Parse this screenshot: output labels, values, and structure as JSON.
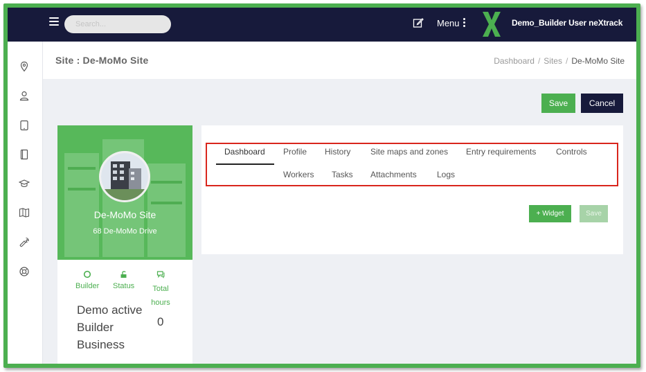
{
  "topbar": {
    "search_placeholder": "Search...",
    "menu_label": "Menu",
    "user_label": "Demo_Builder User neXtrack"
  },
  "sidebar": {
    "icons": [
      "location-pin-icon",
      "user-icon",
      "tablet-icon",
      "book-icon",
      "graduation-cap-icon",
      "map-book-icon",
      "wrench-icon",
      "lifebuoy-icon"
    ]
  },
  "page": {
    "title": "Site : De-MoMo Site",
    "breadcrumb": [
      "Dashboard",
      "Sites",
      "De-MoMo Site"
    ],
    "breadcrumb_sep": "/"
  },
  "actions": {
    "save_label": "Save",
    "cancel_label": "Cancel"
  },
  "site_card": {
    "name": "De-MoMo Site",
    "address": "68 De-MoMo Drive",
    "stats": [
      {
        "icon": "circle-icon",
        "label": "Builder"
      },
      {
        "icon": "unlock-icon",
        "label": "Status"
      },
      {
        "icon": "chat-icon",
        "label": "Total hours"
      }
    ],
    "status_text": "Demo active Builder Business",
    "total_hours": "0"
  },
  "tabs": {
    "row1": [
      "Dashboard",
      "Profile",
      "History",
      "Site maps and zones",
      "Entry requirements",
      "Controls"
    ],
    "row2": [
      "Workers",
      "Tasks",
      "Attachments",
      "Logs"
    ],
    "active": "Dashboard"
  },
  "dashboard": {
    "widget_label": "+ Widget",
    "save_label": "Save"
  },
  "colors": {
    "accent_green": "#4caf50",
    "navy": "#171a3b",
    "highlight_red": "#d9251c"
  }
}
